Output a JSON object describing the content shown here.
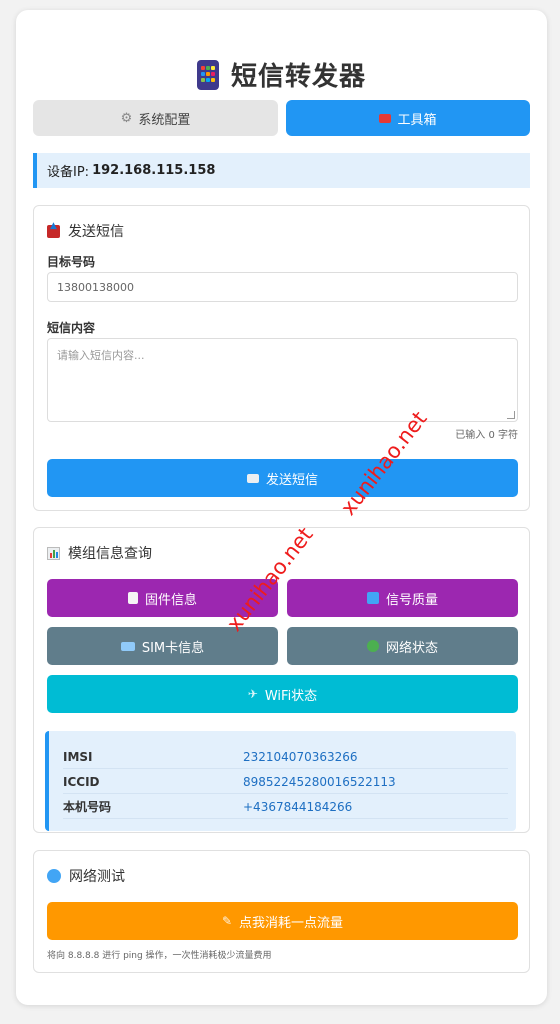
{
  "app": {
    "title": "短信转发器"
  },
  "tabs": {
    "config": "系统配置",
    "tools": "工具箱"
  },
  "device": {
    "ip_label": "设备IP:",
    "ip_value": "192.168.115.158"
  },
  "send_sms": {
    "title": "发送短信",
    "target_label": "目标号码",
    "target_placeholder": "13800138000",
    "content_label": "短信内容",
    "content_placeholder": "请输入短信内容...",
    "counter": "已输入 0 字符",
    "send_button": "发送短信"
  },
  "module_info": {
    "title": "模组信息查询",
    "buttons": {
      "firmware": "固件信息",
      "signal": "信号质量",
      "sim": "SIM卡信息",
      "network": "网络状态",
      "wifi": "WiFi状态"
    },
    "rows": [
      {
        "key": "IMSI",
        "value": "232104070363266"
      },
      {
        "key": "ICCID",
        "value": "89852245280016522113"
      },
      {
        "key": "本机号码",
        "value": "+4367844184266"
      }
    ]
  },
  "network_test": {
    "title": "网络测试",
    "button": "点我消耗一点流量",
    "note": "将向 8.8.8.8 进行 ping 操作，一次性消耗极少流量费用"
  },
  "watermark": "xunihao.net",
  "colors": {
    "primary": "#2196f3",
    "purple": "#9c27b0",
    "grey": "#607d8b",
    "cyan": "#00bcd4",
    "orange": "#ff9800",
    "watermark": "#ee1c1c"
  }
}
